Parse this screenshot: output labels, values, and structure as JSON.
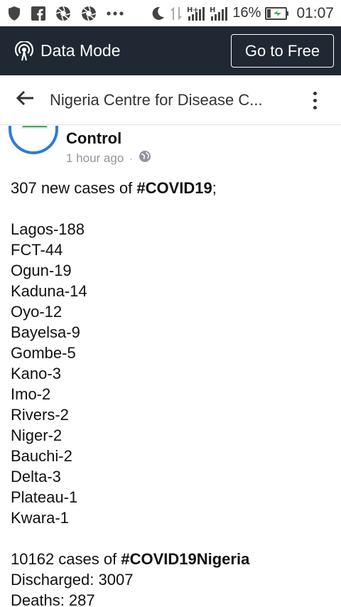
{
  "status_bar": {
    "battery_percent": "16%",
    "time": "01:07",
    "icons": [
      "shield-icon",
      "facebook-icon",
      "aperture-icon",
      "aperture-icon",
      "more-dots-icon",
      "moon-icon",
      "data-arrows-icon",
      "signal-h-plus-icon",
      "signal-h-icon",
      "battery-charging-icon"
    ]
  },
  "data_mode": {
    "label": "Data Mode",
    "button_label": "Go to Free",
    "icon": "broadcast-icon"
  },
  "header": {
    "title": "Nigeria Centre for Disease C...",
    "back_icon": "back-arrow-icon",
    "more_icon": "more-vertical-icon"
  },
  "post": {
    "page_name": "Control",
    "time": "1 hour ago",
    "privacy_icon": "globe-icon",
    "intro_prefix": "307 new cases of ",
    "intro_tag": "#COVID19",
    "intro_suffix": ";",
    "states": [
      "Lagos-188",
      "FCT-44",
      "Ogun-19",
      "Kaduna-14",
      "Oyo-12",
      "Bayelsa-9",
      "Gombe-5",
      "Kano-3",
      "Imo-2",
      "Rivers-2",
      "Niger-2",
      "Bauchi-2",
      "Delta-3",
      "Plateau-1",
      "Kwara-1"
    ],
    "total_prefix": "10162 cases of ",
    "total_tag": "#COVID19Nigeria",
    "discharged": "Discharged: 3007",
    "deaths": "Deaths: 287"
  },
  "colors": {
    "data_bar_bg": "#1f2833",
    "avatar_ring": "#2f7bd9",
    "meta_text": "#90949c"
  }
}
